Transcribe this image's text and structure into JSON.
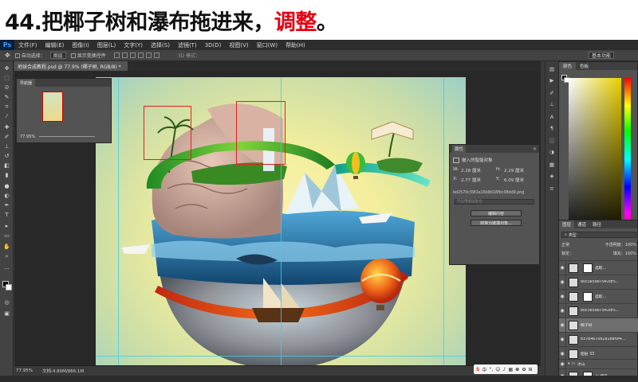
{
  "slide": {
    "title_main": "44.把椰子树和瀑布拖进来，",
    "title_accent": "调整",
    "title_tail": "。"
  },
  "app": {
    "logo": "Ps",
    "menu": [
      "文件(F)",
      "编辑(E)",
      "图像(I)",
      "图层(L)",
      "文字(Y)",
      "选择(S)",
      "滤镜(T)",
      "3D(D)",
      "视图(V)",
      "窗口(W)",
      "帮助(H)"
    ],
    "options": {
      "auto_select": "自动选择：",
      "auto_select_value": "图层",
      "show_transform": "显示变换控件",
      "mode_3d": "3D 模式："
    },
    "workspace": "基本功能",
    "doc_tab": "地球合成教程.psd @ 77.9% (椰子树, RGB/8) *"
  },
  "navigator": {
    "tab": "导航器",
    "zoom": "77.95%"
  },
  "properties": {
    "tab": "属性",
    "type": "嵌入的智能对象",
    "w_label": "W:",
    "w_value": "2.28 厘米",
    "h_label": "H:",
    "h_value": "2.29 厘米",
    "x_label": "X:",
    "x_value": "2.77 厘米",
    "y_label": "Y:",
    "y_value": "6.09 厘米",
    "filename": "bd2570c39f2a16b8d18fbc08dd9.png",
    "comp_placeholder": "不应用图层复合",
    "btn_edit": "编辑内容",
    "btn_convert": "转换为链接对象..."
  },
  "color_panel": {
    "tab_color": "颜色",
    "tab_swatches": "色板"
  },
  "layers": {
    "tab_layers": "图层",
    "tab_channels": "通道",
    "tab_paths": "路径",
    "filter": "类型",
    "blend": "正常",
    "opacity_label": "不透明度：",
    "opacity": "100%",
    "lock_label": "锁定：",
    "fill_label": "填充：",
    "fill": "100%",
    "items": [
      {
        "name": "选取...",
        "selected": false
      },
      {
        "name": "b0c3e5de7942df5...",
        "selected": false
      },
      {
        "name": "选取...",
        "selected": false
      },
      {
        "name": "b0c3e5de7942df5...",
        "selected": false
      },
      {
        "name": "椰子树",
        "selected": true
      },
      {
        "name": "837b4670d2a18af9f4...",
        "selected": false
      },
      {
        "name": "图层 33",
        "selected": false
      },
      {
        "name": "冰山",
        "selected": false
      },
      {
        "name": "山 拷贝",
        "selected": false
      }
    ]
  },
  "status": {
    "zoom": "77.95%",
    "doc": "文档:4.80M/866.1M"
  },
  "ime": {
    "s": "S",
    "items": [
      "中",
      "°,",
      "☺",
      "♪",
      "▦",
      "♚",
      "✿",
      "⊞"
    ]
  }
}
